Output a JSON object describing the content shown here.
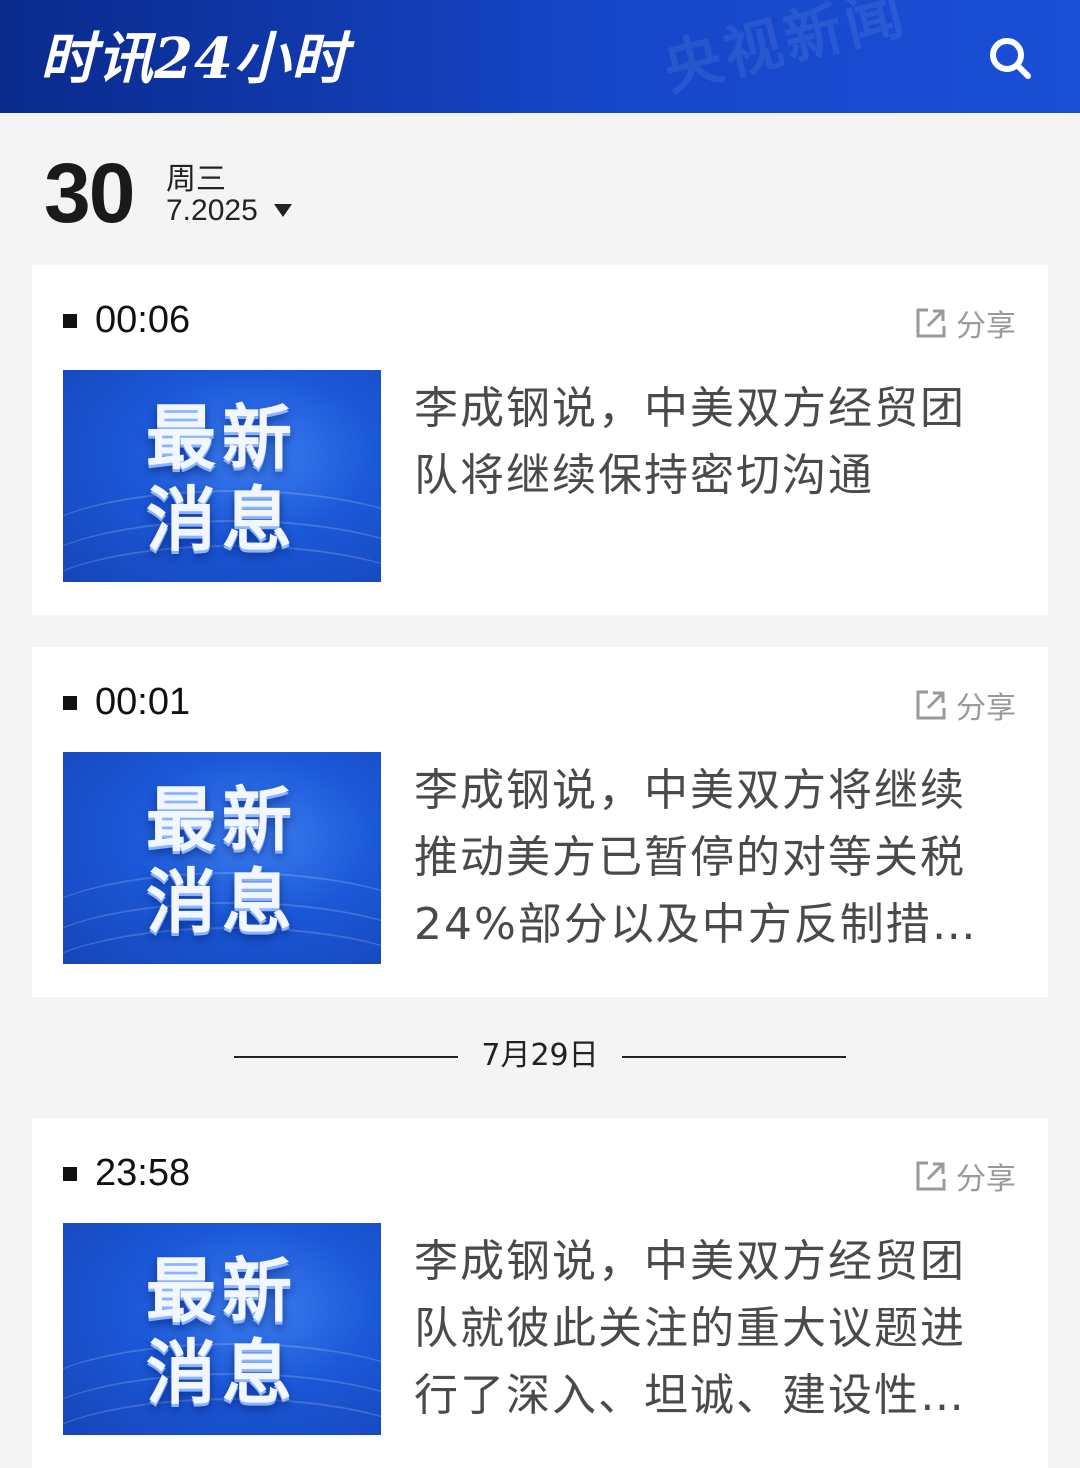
{
  "header": {
    "title": "时讯24小时",
    "watermark": "央视新闻",
    "search_icon": "search-icon",
    "brand_color": "#1646c8"
  },
  "date": {
    "day": "30",
    "weekday": "周三",
    "month_year": "7.2025"
  },
  "thumbnail": {
    "line1": "最新",
    "line2": "消息"
  },
  "share_label": "分享",
  "items": [
    {
      "time": "00:06",
      "headline": "李成钢说，中美双方经贸团队将继续保持密切沟通"
    },
    {
      "time": "00:01",
      "headline": "李成钢说，中美双方将继续推动美方已暂停的对等关税24%部分以及中方反制措…"
    },
    {
      "time": "23:58",
      "headline": "李成钢说，中美双方经贸团队就彼此关注的重大议题进行了深入、坦诚、建设性…"
    }
  ],
  "section_divider": "7月29日"
}
